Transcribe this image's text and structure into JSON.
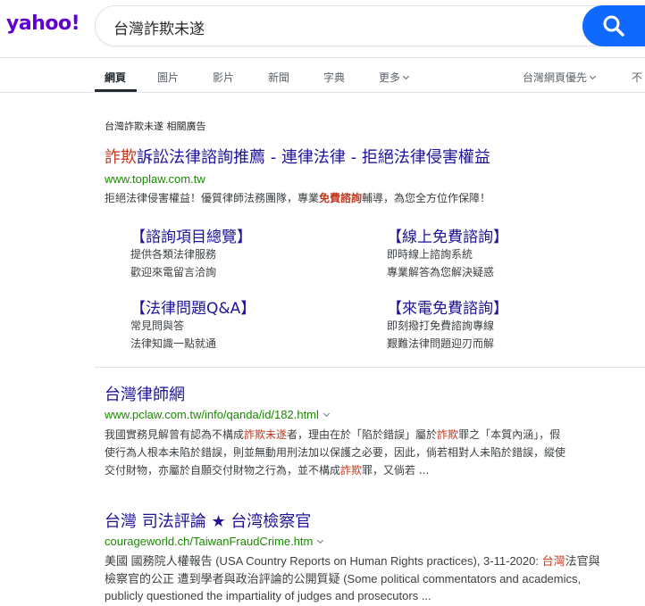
{
  "header": {
    "logo_text": "yahoo!",
    "search_query": "台灣詐欺未遂",
    "search_button_label": ""
  },
  "tabs": [
    {
      "label": "網頁",
      "active": true
    },
    {
      "label": "圖片"
    },
    {
      "label": "影片"
    },
    {
      "label": "新聞"
    },
    {
      "label": "字典"
    },
    {
      "label": "更多"
    },
    {
      "label": "台灣網頁優先"
    },
    {
      "label": "不"
    }
  ],
  "ad": {
    "label": "台灣詐欺未遂 相關廣告",
    "title_highlight": "詐欺",
    "title_rest": "訴訟法律諮詢推薦 - 連律法律 - 拒絕法律侵害權益",
    "url": "www.toplaw.com.tw",
    "snippet_before": "拒絕法律侵害權益！優質律師法務團隊，專業",
    "snippet_highlight": "免費諮詢",
    "snippet_after": "輔導，為您全方位作保障！",
    "sitelinks": [
      {
        "title": "【諮詢項目總覽】",
        "line1": "提供各類法律服務",
        "line2": "歡迎來電留言洽詢"
      },
      {
        "title": "【線上免費諮詢】",
        "line1": "即時線上諮詢系統",
        "line2": "專業解答為您解決疑惑"
      },
      {
        "title": "【法律問題Q&A】",
        "line1": "常見問與答",
        "line2": "法律知識一點就通"
      },
      {
        "title": "【來電免費諮詢】",
        "line1": "即刻撥打免費諮詢專線",
        "line2": "艱難法律問題迎刃而解"
      }
    ]
  },
  "results": [
    {
      "title": "台灣律師網",
      "url": "www.pclaw.com.tw/info/qanda/id/182.html",
      "line1_a": "我國實務見解曾有認為不構成",
      "line1_h1": "詐欺未遂",
      "line1_b": "者，理由在於「陷於錯誤」屬於",
      "line1_h2": "詐欺",
      "line1_c": "罪之「本質內涵」，假",
      "line2": "使行為人根本未陷於錯誤，則並無動用刑法加以保護之必要，因此，倘若相對人未陷於錯誤，縱使",
      "line3_a": "交付財物，亦屬於自願交付財物之行為，並不構成",
      "line3_h": "詐欺",
      "line3_b": "罪，又倘若 ..."
    },
    {
      "title": "台灣 司法評論 ★ 台湾檢察官",
      "url": "courageworld.ch/TaiwanFraudCrime.htm",
      "line1_a": "美國 國務院人權報告 (USA Country Reports on Human Rights practices), 3-11-2020: ",
      "line1_h": "台灣",
      "line1_b": "法官與",
      "line2": "檢察官的公正 遭到學者與政治評論的公開質疑 (Some political commentators and academics,",
      "line3": "publicly questioned the impartiality of judges and prosecutors ..."
    }
  ]
}
